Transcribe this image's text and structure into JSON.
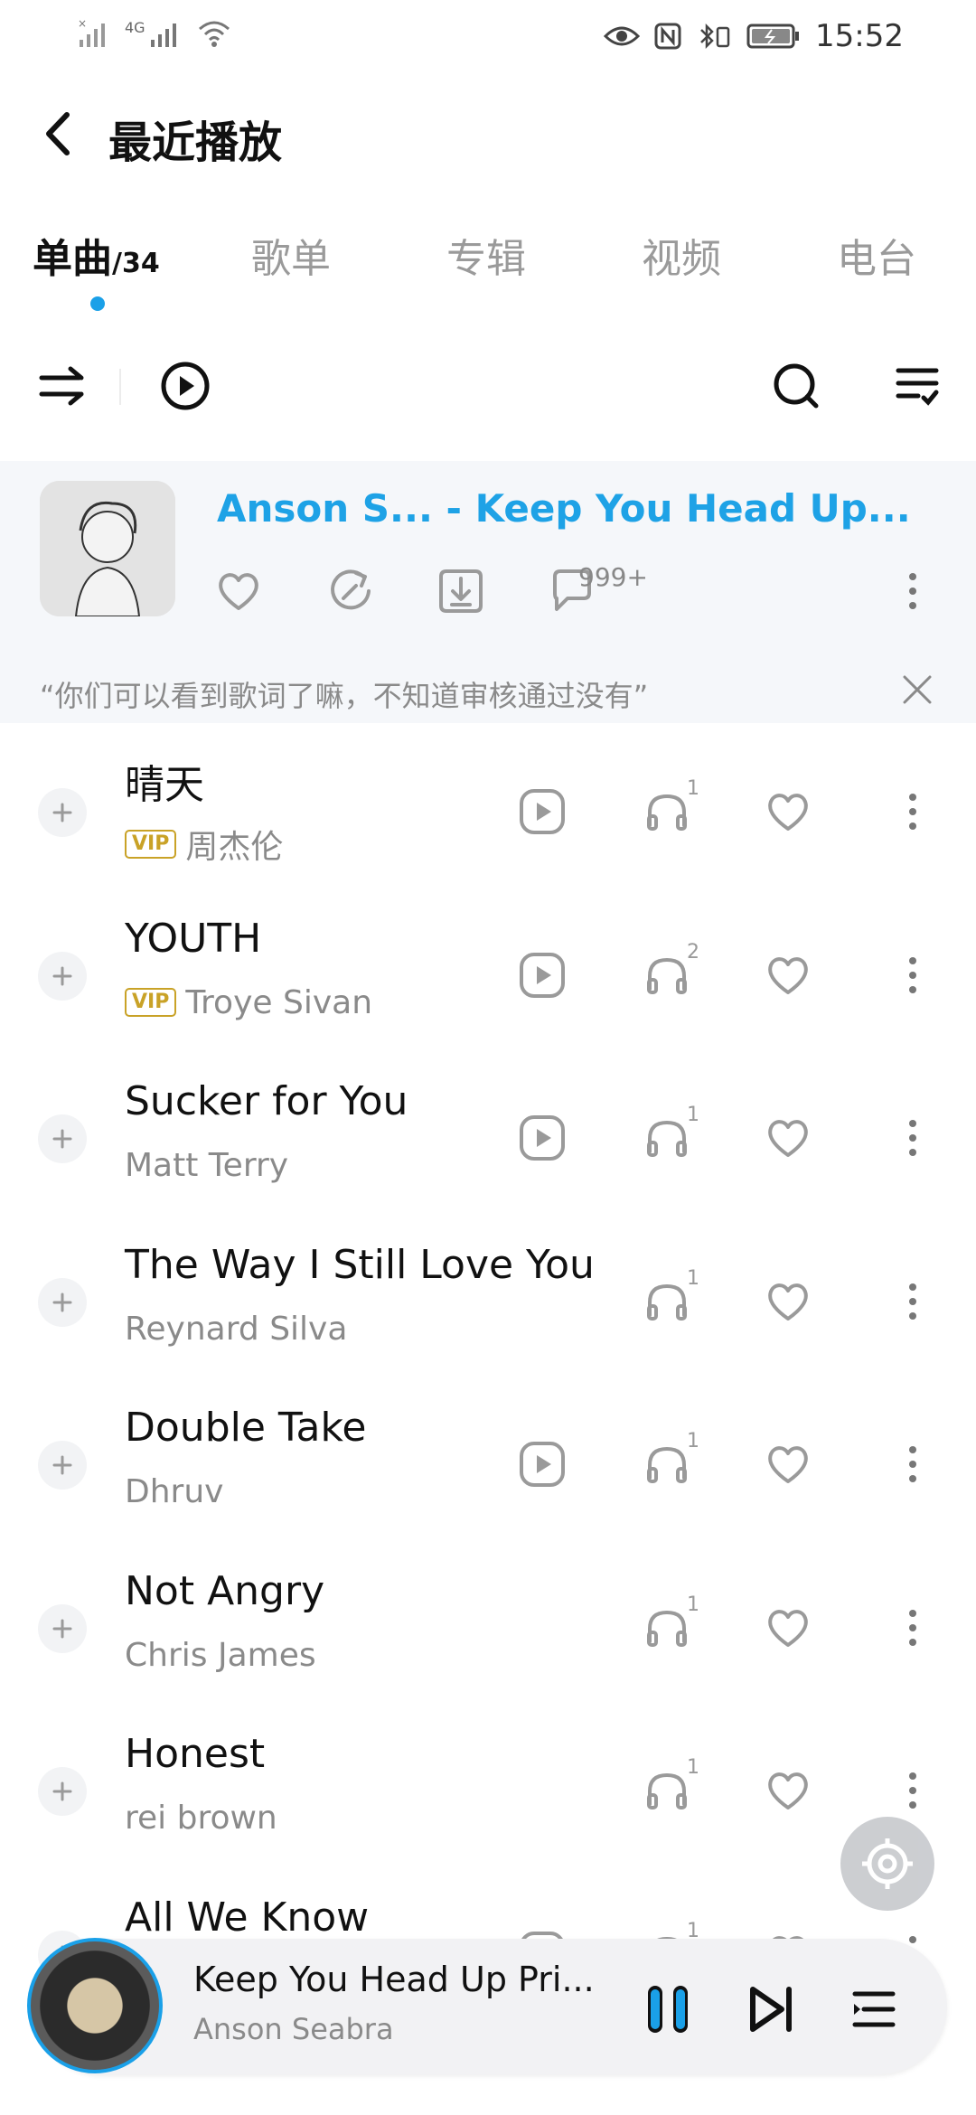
{
  "status_bar": {
    "time": "15:52",
    "network": "4G"
  },
  "header": {
    "title": "最近播放"
  },
  "tabs": [
    {
      "label": "单曲",
      "count": "/34",
      "active": true
    },
    {
      "label": "歌单"
    },
    {
      "label": "专辑"
    },
    {
      "label": "视频"
    },
    {
      "label": "电台"
    }
  ],
  "now_playing": {
    "title": "Anson S... - Keep You Head Up...",
    "comment_count": "999+",
    "lyric_notice": "“你们可以看到歌词了嘛，不知道审核通过没有”"
  },
  "songs": [
    {
      "title": "晴天",
      "artist": "周杰伦",
      "vip": "VIP",
      "has_video": true,
      "listen_count": "1"
    },
    {
      "title": "YOUTH",
      "artist": "Troye Sivan",
      "vip": "VIP",
      "has_video": true,
      "listen_count": "2"
    },
    {
      "title": "Sucker for You",
      "artist": "Matt Terry",
      "has_video": true,
      "listen_count": "1"
    },
    {
      "title": "The Way I Still Love You",
      "artist": "Reynard Silva",
      "has_video": false,
      "listen_count": "1"
    },
    {
      "title": "Double Take",
      "artist": "Dhruv",
      "has_video": true,
      "listen_count": "1"
    },
    {
      "title": "Not Angry",
      "artist": "Chris James",
      "has_video": false,
      "listen_count": "1"
    },
    {
      "title": "Honest",
      "artist": "rei brown",
      "has_video": false,
      "listen_count": "1"
    },
    {
      "title": "All We Know",
      "artist": "",
      "has_video": true,
      "listen_count": "1"
    }
  ],
  "mini_player": {
    "title": "Keep You Head Up Pri...",
    "artist": "Anson Seabra"
  },
  "colors": {
    "accent": "#1ea2e6",
    "vip": "#c9a227",
    "icon_grey": "#9a9a9a"
  }
}
